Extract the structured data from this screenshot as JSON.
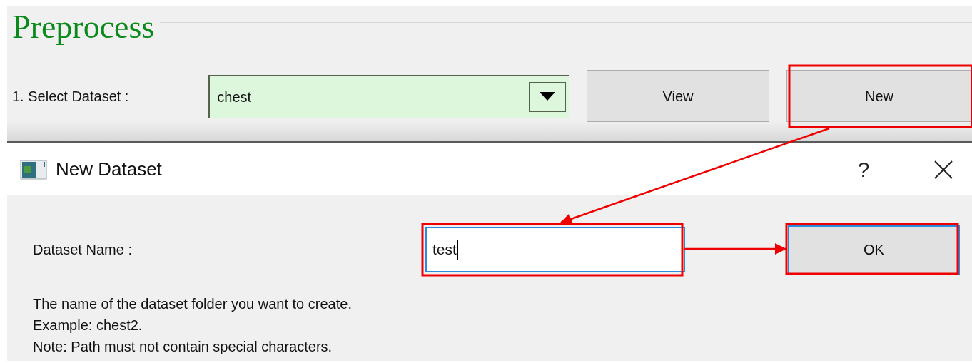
{
  "panel": {
    "title": "Preprocess",
    "dataset_label": "1. Select Dataset :",
    "dataset_value": "chest",
    "buttons": [
      "View",
      "New"
    ]
  },
  "dialog": {
    "title": "New Dataset",
    "help_button": "?",
    "name_label": "Dataset Name :",
    "name_value": "test",
    "ok_button": "OK",
    "help_lines": [
      "The name of the dataset folder you want to create.",
      "Example: chest2.",
      "Note: Path must not contain special characters."
    ]
  }
}
